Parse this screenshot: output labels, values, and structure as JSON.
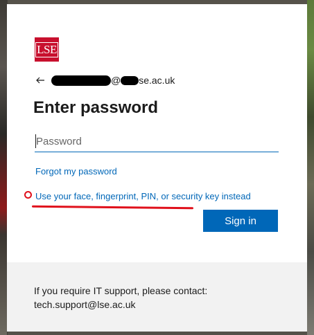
{
  "logo": {
    "text": "LSE",
    "color": "#c8102e"
  },
  "identity": {
    "back_icon": "back-arrow-icon",
    "email_suffix": "se.ac.uk",
    "at_sign": "@"
  },
  "title": "Enter password",
  "password": {
    "placeholder": "Password",
    "value": ""
  },
  "links": {
    "forgot": "Forgot my password",
    "alternative": "Use your face, fingerprint, PIN, or security key instead"
  },
  "buttons": {
    "sign_in": "Sign in"
  },
  "footer": {
    "line1": "If you require IT support, please contact:",
    "line2": "tech.support@lse.ac.uk"
  },
  "colors": {
    "accent": "#0067b8",
    "annotation": "#e0101b",
    "footer_bg": "#f2f2f2"
  }
}
